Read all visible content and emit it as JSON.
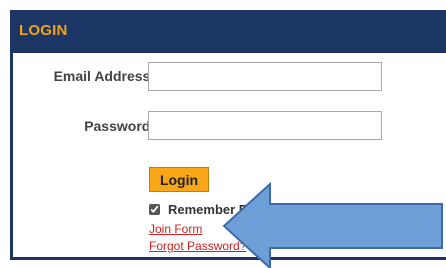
{
  "login_panel": {
    "title": "LOGIN",
    "email_label": "Email Address:",
    "email_value": "",
    "password_label": "Password:",
    "password_value": "",
    "login_button_label": "Login",
    "remember_checked": true,
    "remember_label": "Remember Email Address",
    "join_link": "Join Form",
    "forgot_link": "Forgot Password?"
  },
  "colors": {
    "header_background": "#1b3664",
    "title_color": "#f2a316",
    "button_background": "#f7a718",
    "link_color": "#cc1f1f",
    "arrow_fill": "#6f9fd8",
    "arrow_stroke": "#3d6aa8"
  },
  "annotation": {
    "icon": "arrow-left-icon"
  }
}
